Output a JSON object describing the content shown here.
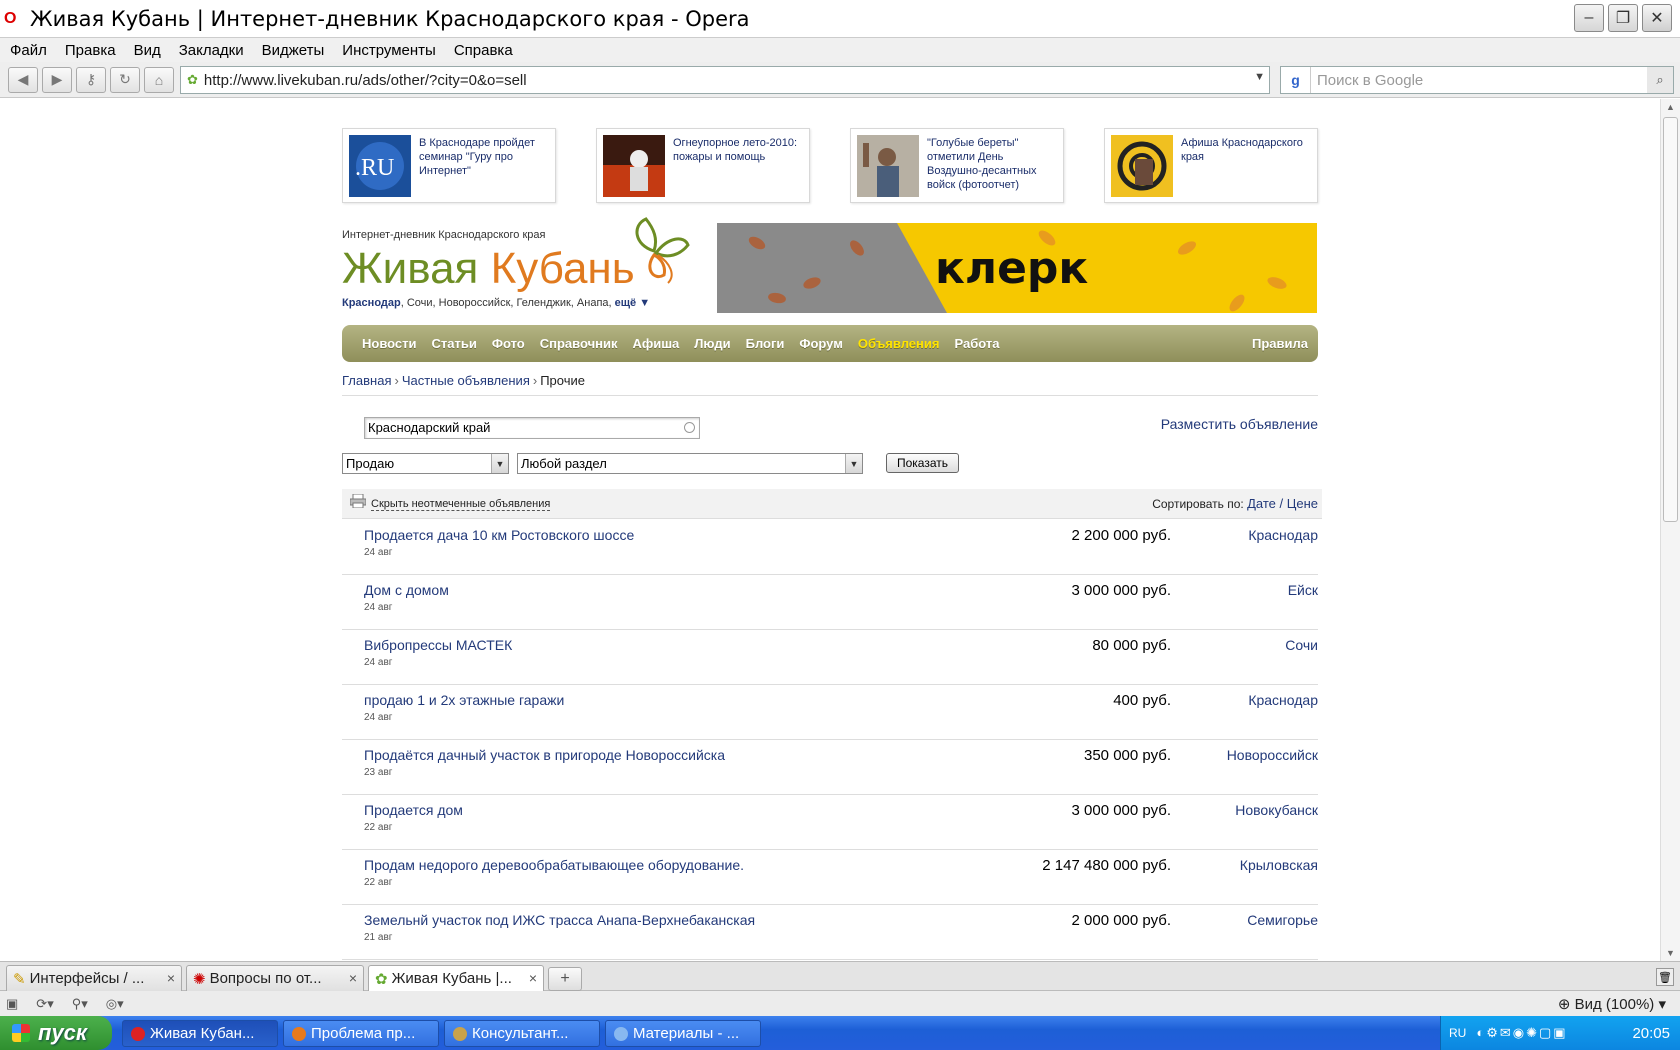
{
  "window": {
    "title": "Живая Кубань | Интернет-дневник Краснодарского края - Opera"
  },
  "menu": [
    "Файл",
    "Правка",
    "Вид",
    "Закладки",
    "Виджеты",
    "Инструменты",
    "Справка"
  ],
  "address": {
    "url": "http://www.livekuban.ru/ads/other/?city=0&o=sell"
  },
  "search": {
    "placeholder": "Поиск в Google"
  },
  "teasers": [
    {
      "text": "В Краснодаре пройдет семинар \"Гуру про Интернет\""
    },
    {
      "text": "Огнеупорное лето-2010: пожары и помощь"
    },
    {
      "text": "\"Голубые береты\" отметили День Воздушно-десантных войск (фотоотчет)"
    },
    {
      "text": "Афиша Краснодарского края"
    }
  ],
  "header": {
    "tagline": "Интернет-дневник Краснодарского края",
    "logo_part1": "Живая",
    "logo_part2": "Кубань",
    "city_main": "Краснодар",
    "city_list": ", Сочи, Новороссийск, Геленджик, Анапа,",
    "more": "ещё ▼",
    "banner_text": "клерк"
  },
  "nav": {
    "items": [
      "Новости",
      "Статьи",
      "Фото",
      "Справочник",
      "Афиша",
      "Люди",
      "Блоги",
      "Форум",
      "Объявления",
      "Работа"
    ],
    "active_index": 8,
    "rules": "Правила"
  },
  "breadcrumb": {
    "home": "Главная",
    "section": "Частные объявления",
    "current": "Прочие",
    "sep": "›"
  },
  "filters": {
    "region": "Краснодарский край",
    "place_ad": "Разместить объявление",
    "deal_type": "Продаю",
    "category": "Любой раздел",
    "show_button": "Показать"
  },
  "listhead": {
    "hide_unmarked": "Скрыть неотмеченные объявления",
    "sort_label": "Сортировать по:",
    "sort_date": "Дате",
    "sort_sep": " / ",
    "sort_price": "Цене"
  },
  "ads": [
    {
      "title": "Продается дача 10 км Ростовского шоссе",
      "date": "24 авг",
      "price": "2 200 000 руб.",
      "city": "Краснодар"
    },
    {
      "title": "Дом с домом",
      "date": "24 авг",
      "price": "3 000 000 руб.",
      "city": "Ейск"
    },
    {
      "title": "Вибропрессы МАСТЕК",
      "date": "24 авг",
      "price": "80 000 руб.",
      "city": "Сочи"
    },
    {
      "title": "продаю 1 и 2х этажные гаражи",
      "date": "24 авг",
      "price": "400 руб.",
      "city": "Краснодар"
    },
    {
      "title": "Продаётся дачный участок в пригороде Новороссийска",
      "date": "23 авг",
      "price": "350 000 руб.",
      "city": "Новороссийск"
    },
    {
      "title": "Продается дом",
      "date": "22 авг",
      "price": "3 000 000 руб.",
      "city": "Новокубанск"
    },
    {
      "title": "Продам недорого деревообрабатывающее оборудование.",
      "date": "22 авг",
      "price": "2 147 480 000 руб.",
      "city": "Крыловская"
    },
    {
      "title": "Земельнй участок под ИЖС трасса Анапа-Верхнебаканская",
      "date": "21 авг",
      "price": "2 000 000 руб.",
      "city": "Семигорье"
    }
  ],
  "tabs": [
    {
      "label": "Интерфейсы / ...",
      "close": "×"
    },
    {
      "label": "Вопросы по от...",
      "close": "×"
    },
    {
      "label": "Живая Кубань |...",
      "close": "×"
    }
  ],
  "newtab": "+",
  "status": {
    "zoom": "Вид (100%)"
  },
  "taskbar": {
    "start": "пуск",
    "tasks": [
      "Живая Кубан...",
      "Проблема пр...",
      "Консультант...",
      "Материалы - ..."
    ],
    "lang": "RU",
    "clock": "20:05"
  },
  "colors": {
    "link": "#233a7a",
    "nav_active": "#ffe400",
    "logo_green": "#6d8d24",
    "logo_orange": "#e07a1f"
  }
}
